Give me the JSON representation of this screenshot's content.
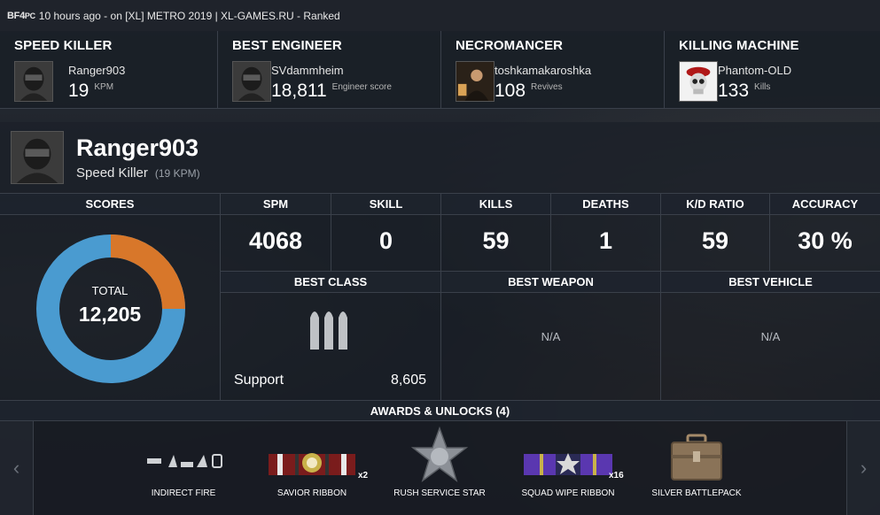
{
  "topbar": {
    "logo": "BF4",
    "platform": "PC",
    "info": "10 hours ago - on [XL] METRO 2019 | XL-GAMES.RU - Ranked"
  },
  "top_awards": [
    {
      "title": "SPEED KILLER",
      "player": "Ranger903",
      "value": "19",
      "unit": "KPM",
      "icon": "soldier-avatar"
    },
    {
      "title": "BEST ENGINEER",
      "player": "SVdammheim",
      "value": "18,811",
      "unit": "Engineer score",
      "icon": "soldier-avatar"
    },
    {
      "title": "NECROMANCER",
      "player": "toshkamakaroshka",
      "value": "108",
      "unit": "Revives",
      "icon": "photo-avatar"
    },
    {
      "title": "KILLING MACHINE",
      "player": "Phantom-OLD",
      "value": "133",
      "unit": "Kills",
      "icon": "skull-avatar"
    }
  ],
  "player": {
    "name": "Ranger903",
    "title": "Speed Killer",
    "sub": "(19 KPM)"
  },
  "scores": {
    "header": "SCORES",
    "total_label": "TOTAL",
    "total_value": "12,205",
    "orange_fraction": 0.25,
    "colors": {
      "blue": "#4a9bd0",
      "orange": "#d8772a"
    }
  },
  "stats": [
    {
      "label": "SPM",
      "value": "4068"
    },
    {
      "label": "SKILL",
      "value": "0"
    },
    {
      "label": "KILLS",
      "value": "59"
    },
    {
      "label": "DEATHS",
      "value": "1"
    },
    {
      "label": "K/D RATIO",
      "value": "59"
    },
    {
      "label": "ACCURACY",
      "value": "30 %"
    }
  ],
  "best": {
    "class_header": "BEST CLASS",
    "class_name": "Support",
    "class_score": "8,605",
    "weapon_header": "BEST WEAPON",
    "weapon_value": "N/A",
    "vehicle_header": "BEST VEHICLE",
    "vehicle_value": "N/A"
  },
  "awards_header": "AWARDS & UNLOCKS (4)",
  "unlocks": [
    {
      "label": "INDIRECT FIRE",
      "mult": ""
    },
    {
      "label": "SAVIOR RIBBON",
      "mult": "x2"
    },
    {
      "label": "RUSH SERVICE STAR",
      "mult": ""
    },
    {
      "label": "SQUAD WIPE RIBBON",
      "mult": "x16"
    },
    {
      "label": "SILVER BATTLEPACK",
      "mult": ""
    }
  ],
  "nav": {
    "left": "‹",
    "right": "›"
  }
}
